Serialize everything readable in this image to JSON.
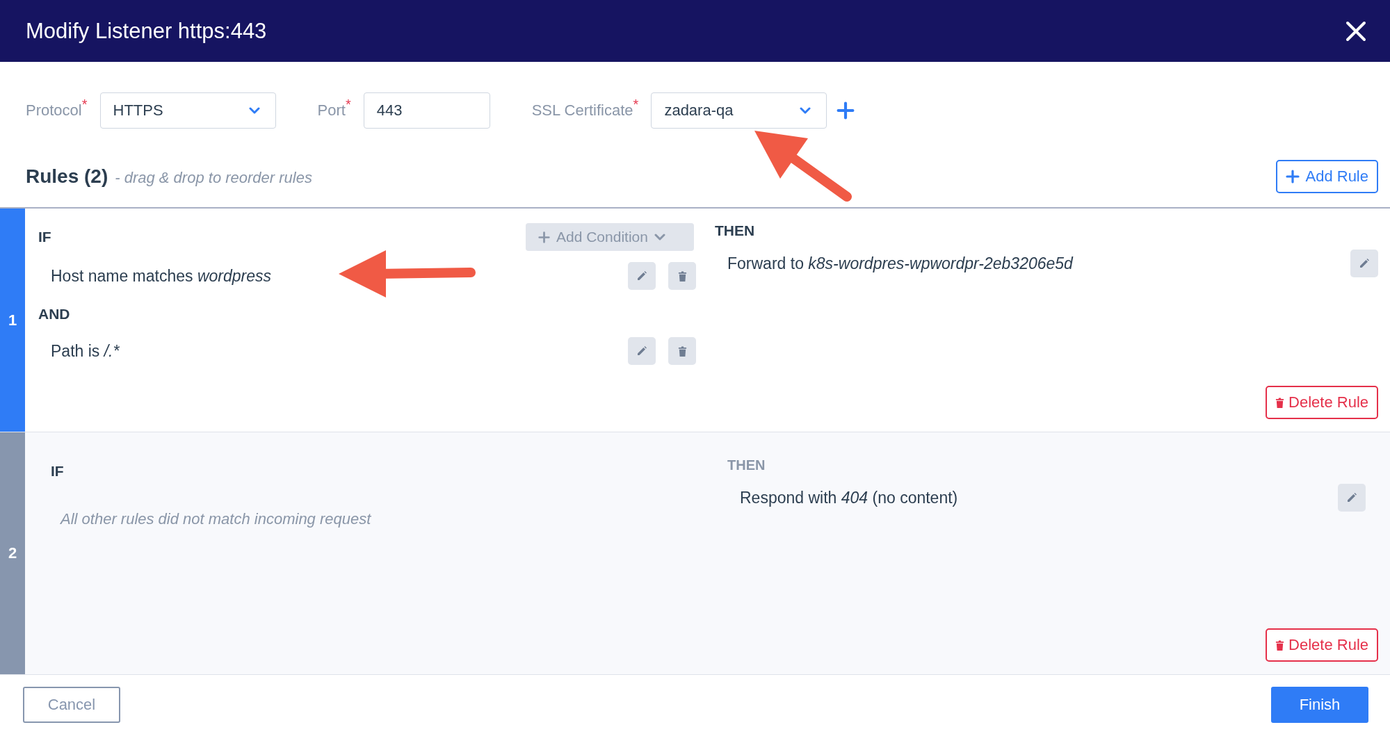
{
  "dialog": {
    "title": "Modify Listener https:443"
  },
  "fields": [
    {
      "kind": "select",
      "label": "Protocol",
      "required_mark": "*",
      "value": "HTTPS",
      "has_add": false
    },
    {
      "kind": "input",
      "label": "Port",
      "required_mark": "*",
      "value": "443",
      "has_add": false
    },
    {
      "kind": "select",
      "label": "SSL Certificate",
      "required_mark": "*",
      "value": "zadara-qa",
      "has_add": true
    }
  ],
  "rules_header": {
    "title": "Rules (2)",
    "hint": "- drag & drop to reorder rules",
    "add_button": "Add Rule"
  },
  "rules": [
    {
      "kind": "custom",
      "number": "1",
      "if_label": "IF",
      "add_condition": "Add Condition",
      "conditions": [
        {
          "prefix": "Host name matches",
          "value": "wordpress"
        },
        {
          "joiner": "AND",
          "prefix": "Path is",
          "value": "/.*"
        }
      ],
      "then_label": "THEN",
      "action": {
        "prefix": "Forward to",
        "value": "k8s-wordpres-wpwordpr-2eb3206e5d"
      },
      "delete_button": "Delete Rule"
    },
    {
      "kind": "default",
      "number": "2",
      "if_label": "IF",
      "note": "All other rules did not match incoming request",
      "then_label": "THEN",
      "action": {
        "prefix": "Respond with",
        "value": "404",
        "suffix": "(no content)"
      },
      "delete_button": "Delete Rule"
    }
  ],
  "footer": {
    "buttons": [
      {
        "kind": "secondary",
        "label": "Cancel"
      },
      {
        "kind": "primary",
        "label": "Finish"
      }
    ]
  }
}
